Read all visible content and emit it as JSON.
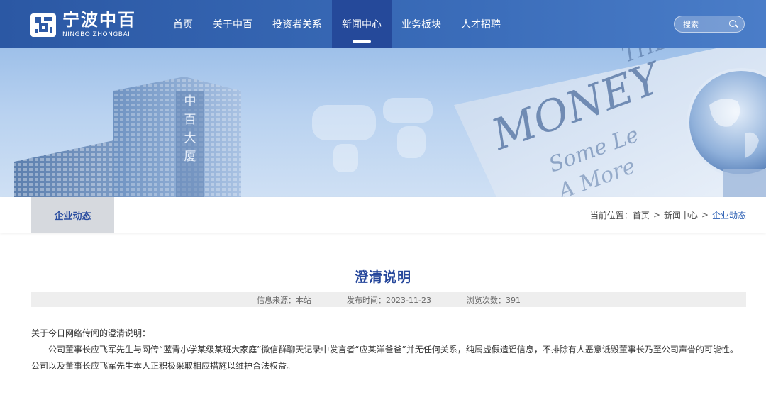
{
  "logo": {
    "cn": "宁波中百",
    "en": "NINGBO ZHONGBAI"
  },
  "nav": {
    "items": [
      {
        "label": "首页"
      },
      {
        "label": "关于中百"
      },
      {
        "label": "投资者关系"
      },
      {
        "label": "新闻中心"
      },
      {
        "label": "业务板块"
      },
      {
        "label": "人才招聘"
      }
    ],
    "active_index": 3
  },
  "search": {
    "placeholder": "搜索"
  },
  "banner": {
    "building_sign": [
      "中",
      "百",
      "大",
      "厦"
    ],
    "newspaper_words": [
      "MONEY",
      "THE",
      "Some Le",
      "A More"
    ]
  },
  "subbar": {
    "tab_label": "企业动态",
    "breadcrumb_prefix": "当前位置：",
    "breadcrumb": [
      "首页",
      "新闻中心",
      "企业动态"
    ]
  },
  "article": {
    "title": "澄清说明",
    "source": "信息来源：本站",
    "published": "发布时间：2023-11-23",
    "views": "浏览次数：391",
    "paragraph1": "关于今日网络传闻的澄清说明：",
    "paragraph2": "公司董事长应飞军先生与网传“蓝青小学某级某班大家庭”微信群聊天记录中发言者“应某洋爸爸”并无任何关系，纯属虚假造谣信息，不排除有人恶意诋毁董事长乃至公司声誉的可能性。公司以及董事长应飞军先生本人正积极采取相应措施以维护合法权益。"
  },
  "colors": {
    "header": "#2e5aa6",
    "accent": "#26479b",
    "tab_bg": "#d6d9de"
  }
}
